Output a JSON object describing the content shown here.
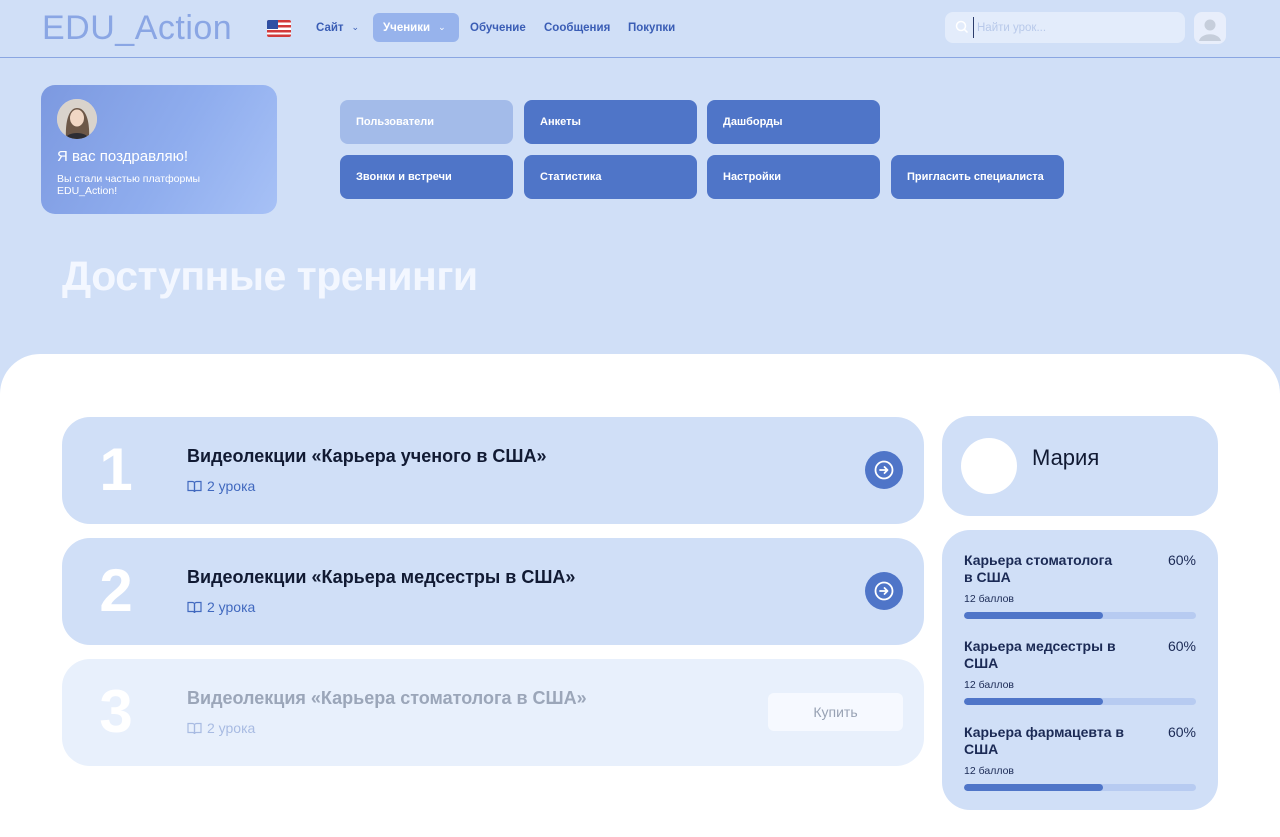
{
  "header": {
    "logo": "EDU_Action",
    "flag_icon": "us-flag-icon",
    "nav": [
      {
        "label": "Сайт",
        "has_dropdown": true,
        "active": false
      },
      {
        "label": "Ученики",
        "has_dropdown": true,
        "active": true
      },
      {
        "label": "Обучение",
        "has_dropdown": false,
        "active": false
      },
      {
        "label": "Сообщения",
        "has_dropdown": false,
        "active": false
      },
      {
        "label": "Покупки",
        "has_dropdown": false,
        "active": false
      }
    ],
    "search_placeholder": "Найти урок...",
    "search_icon": "search-icon",
    "avatar_icon": "user-avatar-icon"
  },
  "welcome": {
    "title": "Я вас поздравляю!",
    "subtitle": "Вы стали частью платформы EDU_Action!"
  },
  "quick_actions": [
    {
      "label": "Пользователи",
      "style": "light"
    },
    {
      "label": "Анкеты",
      "style": "dark"
    },
    {
      "label": "Дашборды",
      "style": "dark"
    },
    {
      "label": "Звонки и встречи",
      "style": "dark"
    },
    {
      "label": "Статистика",
      "style": "dark"
    },
    {
      "label": "Настройки",
      "style": "dark"
    },
    {
      "label": "Пригласить специалиста",
      "style": "dark"
    }
  ],
  "page_title": "Доступные тренинги",
  "courses": [
    {
      "number": "1",
      "title": "Видеолекции «Карьера ученого в США»",
      "lessons": "2 урока",
      "locked": false
    },
    {
      "number": "2",
      "title": "Видеолекции «Карьера медсестры в США»",
      "lessons": "2 урока",
      "locked": false
    },
    {
      "number": "3",
      "title": "Видеолекция «Карьера стоматолога в США»",
      "lessons": "2 урока",
      "locked": true,
      "action_label": "Купить"
    }
  ],
  "profile": {
    "name": "Мария"
  },
  "progress": [
    {
      "title": "Карьера стоматолога в США",
      "percent_label": "60%",
      "score": "12 баллов",
      "progress": 0.6
    },
    {
      "title": "Карьера медсестры в США",
      "percent_label": "60%",
      "score": "12 баллов",
      "progress": 0.6
    },
    {
      "title": "Карьера фармацевта в США",
      "percent_label": "60%",
      "score": "12 баллов",
      "progress": 0.6
    }
  ],
  "colors": {
    "background": "#d0dff7",
    "accent": "#4f75c8",
    "accent_light": "#a3bbe9",
    "panel": "#ffffff"
  }
}
